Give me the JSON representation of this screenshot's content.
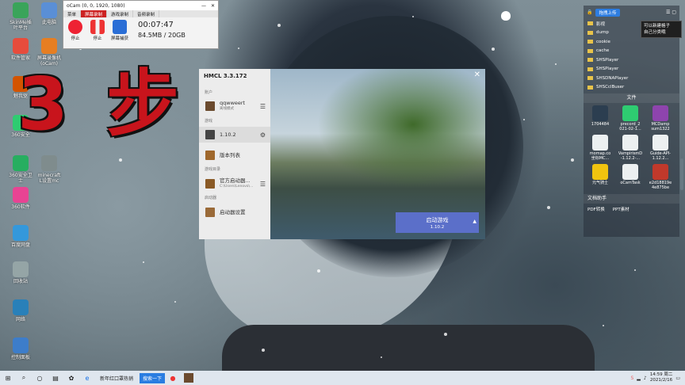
{
  "overlay": {
    "big_text": "3 步"
  },
  "desktop_icons": [
    {
      "label": "SkinMe插\n叶平台",
      "color": "#3aa45a"
    },
    {
      "label": "此电脑",
      "color": "#5a8fd6"
    },
    {
      "label": "软件管家",
      "color": "#e74c3c"
    },
    {
      "label": "屏幕录像机\n(oCam)",
      "color": "#e67e22"
    },
    {
      "label": "魅我驱",
      "color": "#d35400"
    },
    {
      "label": "360安全",
      "color": "#2ecc71"
    },
    {
      "label": "360安全卫\n士",
      "color": "#27ae60"
    },
    {
      "label": "minecraft\nL设置mc",
      "color": "#7f8c8d"
    },
    {
      "label": "360软件",
      "color": "#e84393"
    },
    {
      "label": "百度网盘",
      "color": "#3498db"
    },
    {
      "label": "回收站",
      "color": "#95a5a6"
    },
    {
      "label": "网络",
      "color": "#2980b9"
    },
    {
      "label": "控制面板",
      "color": "#3d7dca"
    }
  ],
  "ocam": {
    "title": "oCam (0, 0, 1920, 1080)",
    "tabs": [
      "菜单",
      "屏幕录制",
      "游戏录制",
      "音频录制"
    ],
    "buttons": [
      "停止",
      "停止",
      "屏幕捕获"
    ],
    "time": "00:07:47",
    "size": "84.5MB / 20GB"
  },
  "hmcl": {
    "title": "HMCL 3.3.172",
    "section_account": "账户",
    "account_name": "qqwweert",
    "account_mode": "离线模式",
    "section_game": "游戏",
    "game_version": "1.10.2",
    "version_list": "版本列表",
    "section_dir": "游戏目录",
    "dir_name": "官方启动器...",
    "dir_path": "C:\\Users\\Lenovo\\...",
    "section_launcher": "启动器",
    "launcher_settings": "启动器设置",
    "launch_label": "启动游戏",
    "launch_version": "1.10.2",
    "close": "✕"
  },
  "right_panel": {
    "upload": "拖拽上传",
    "tooltip": "可以新建格子\n自己分类哦",
    "folders": [
      "影视",
      "dump",
      "cookie",
      "cache",
      "SHSPlayer",
      "SHSPlayer",
      "SHSDNAPlayer",
      "SHSCclBuser"
    ],
    "files_title": "文件",
    "files": [
      {
        "name": "1704484",
        "color": "#2c3e50"
      },
      {
        "name": "precord_2\n021-02-1...",
        "color": "#2ecc71"
      },
      {
        "name": "MCDamp\nsum1322",
        "color": "#8e44ad"
      },
      {
        "name": "momap.co\n坐标MC...",
        "color": "#ecf0f1"
      },
      {
        "name": "VampirismD\n-1.12.2-...",
        "color": "#ecf0f1"
      },
      {
        "name": "Guide-API-\n1.12.2...",
        "color": "#ecf0f1"
      },
      {
        "name": "元气骑士",
        "color": "#f1c40f"
      },
      {
        "name": "oCamTask",
        "color": "#ecf0f1"
      },
      {
        "name": "e2d18819e\n4e875be",
        "color": "#c0392b"
      }
    ],
    "docs_title": "文档助手",
    "docs": [
      "PDF转换",
      "PPT素材"
    ]
  },
  "taskbar": {
    "browser_tab": "新年红口罩热销",
    "search_btn": "搜索一下",
    "time": "14:59 周二",
    "date": "2021/2/16"
  }
}
